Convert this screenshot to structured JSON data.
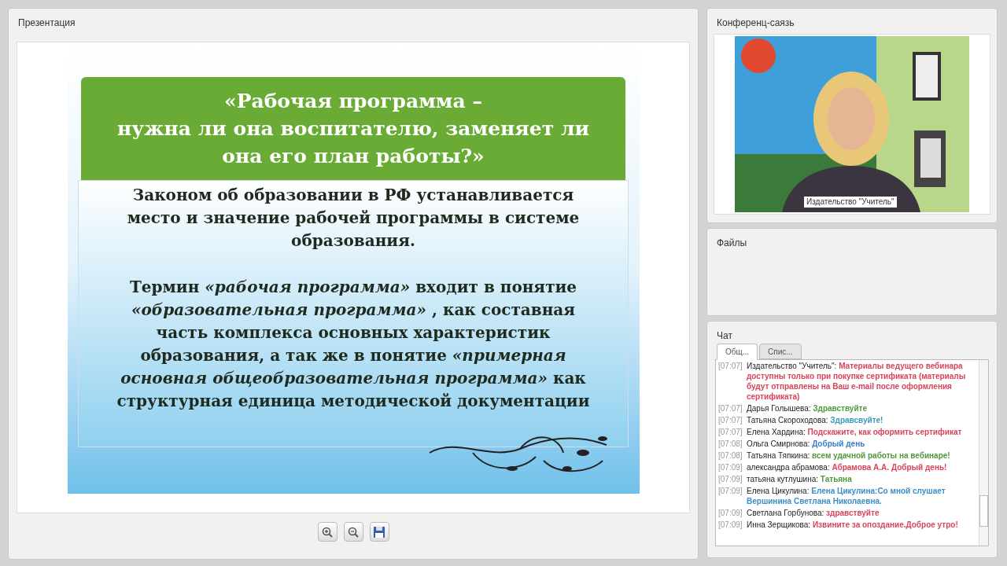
{
  "presentation": {
    "title": "Презентация",
    "slide": {
      "heading": "«Рабочая программа –\nнужна ли она воспитателю, заменяет ли\nона его план работы?»",
      "paragraphs": [
        "Законом об образовании в РФ устанавливается\nместо и  значение рабочей программы в системе\nобразования.",
        "Термин *«рабочая программа»*  входит в понятие\n*«образовательная программа»* , как составная\nчасть комплекса основных характеристик\nобразования, а так же в понятие *«примерная*\n*основная общеобразовательная программа»* как\nструктурная единица методической документации"
      ]
    },
    "toolbar": [
      {
        "kind": "zoom_in"
      },
      {
        "kind": "zoom_out"
      },
      {
        "kind": "save"
      }
    ]
  },
  "conference": {
    "title": "Конференц-саязь",
    "video": {
      "caption": "Издательство \"Учитель\""
    }
  },
  "files": {
    "title": "Файлы"
  },
  "chat": {
    "title": "Чат",
    "tabs": [
      {
        "label": "Общ...",
        "selected": true
      },
      {
        "label": "Спис...",
        "selected": false
      }
    ],
    "messages": [
      {
        "time": "[07:07]",
        "author": "Издательство \"Учитель\":",
        "text": "Материалы ведущего вебинара доступны только при покупке сертификата (материалы будут отправлены на Ваш e-mail после оформления сертификата)",
        "color": "#d9435a"
      },
      {
        "time": "[07:07]",
        "author": "Дарья Голышева:",
        "text": "Здравствуйте",
        "color": "#4e9a3a"
      },
      {
        "time": "[07:07]",
        "author": "Татьяна Скороходова:",
        "text": "Здравсвуйте!",
        "color": "#3a9ab8"
      },
      {
        "time": "[07:07]",
        "author": "Елена Хардина:",
        "text": "Подскажите, как оформить сертификат",
        "color": "#d9435a"
      },
      {
        "time": "[07:08]",
        "author": "Ольга Смирнова:",
        "text": "Добрый день",
        "color": "#3a7fc8"
      },
      {
        "time": "[07:08]",
        "author": "Татьяна Тяпкина:",
        "text": "всем удачной работы на вебинаре!",
        "color": "#4e9a3a"
      },
      {
        "time": "[07:09]",
        "author": "александра абрамова:",
        "text": "Абрамова А.А. Добрый день!",
        "color": "#d9435a"
      },
      {
        "time": "[07:09]",
        "author": "татьяна кутлушина:",
        "text": "Татьяна",
        "color": "#4e9a3a"
      },
      {
        "time": "[07:09]",
        "author": "Елена Цикулина:",
        "text": "Елена Цикулина:Со мной слушает Вершинина Светлана Николаевна.",
        "color": "#3a8fc8"
      },
      {
        "time": "[07:09]",
        "author": "Светлана Горбунова:",
        "text": "здравствуйте",
        "color": "#d9435a"
      },
      {
        "time": "[07:09]",
        "author": "Инна Зерщикова:",
        "text": "Извините за опоздание.Доброе утро!",
        "color": "#d9435a"
      }
    ]
  }
}
